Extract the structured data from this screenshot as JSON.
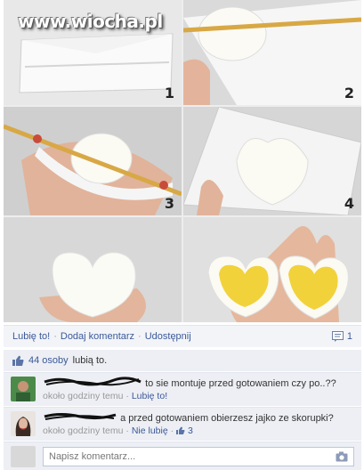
{
  "watermark": "www.wiocha.pl",
  "steps": [
    "1",
    "2",
    "3",
    "4"
  ],
  "actions": {
    "like": "Lubię to!",
    "comment": "Dodaj komentarz",
    "share": "Udostępnij",
    "comment_count": "1"
  },
  "likes": {
    "count_link": "44 osoby",
    "text": "lubią to."
  },
  "comments": [
    {
      "text": "to sie montuje przed gotowaniem czy po..??",
      "time": "około godziny temu",
      "action": "Lubię to!"
    },
    {
      "text": "a przed gotowaniem obierzesz jajko ze skorupki?",
      "time": "około godziny temu",
      "action": "Nie lubię",
      "like_count": "3"
    }
  ],
  "input": {
    "placeholder": "Napisz komentarz..."
  },
  "colors": {
    "link": "#3b5998",
    "panel": "#edeff4",
    "yolk": "#f2d23a"
  },
  "icons": [
    "camera-icon",
    "thumbs-up-icon",
    "comment-icon"
  ]
}
